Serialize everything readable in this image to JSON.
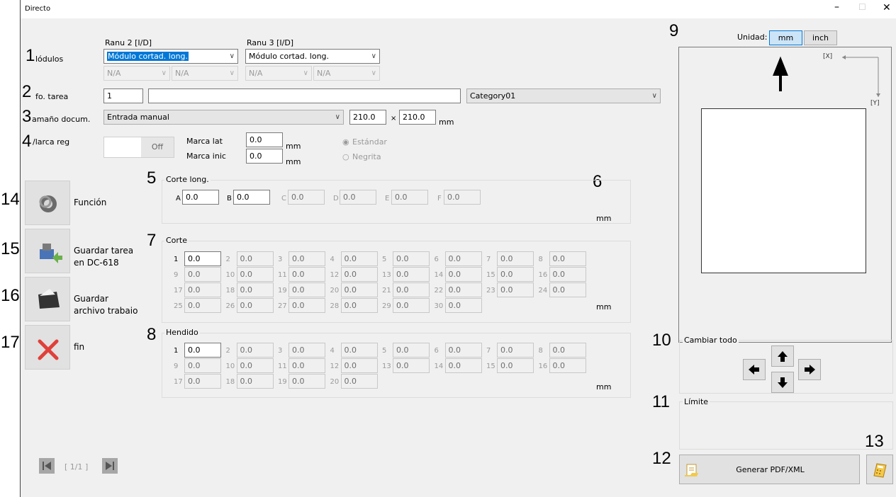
{
  "window": {
    "title": "Directo",
    "minimize": "–",
    "maximize": "☐",
    "close": "✕"
  },
  "callouts": {
    "n1": "1",
    "n2": "2",
    "n3": "3",
    "n4": "4",
    "n5": "5",
    "n6": "6",
    "n7": "7",
    "n8": "8",
    "n9": "9",
    "n10": "10",
    "n11": "11",
    "n12": "12",
    "n13": "13",
    "n14": "14",
    "n15": "15",
    "n16": "16",
    "n17": "17"
  },
  "modules": {
    "label": "lódulos",
    "col2_header": "Ranu 2 [I/D]",
    "col3_header": "Ranu 3 [I/D]",
    "col2_select": "Módulo cortad. long.",
    "col3_select": "Módulo cortad. long.",
    "na": "N/A"
  },
  "job": {
    "label": "fo. tarea",
    "number": "1",
    "name": "",
    "category": "Category01"
  },
  "docsize": {
    "label": "amaño docum.",
    "mode": "Entrada manual",
    "width": "210.0",
    "times": "×",
    "height": "210.0",
    "unit": "mm"
  },
  "regmark": {
    "label": "/larca reg",
    "toggle": "Off",
    "lat_label": "Marca lat",
    "lat_value": "0.0",
    "ini_label": "Marca inic",
    "ini_value": "0.0",
    "unit": "mm",
    "standard": "Estándar",
    "bold": "Negrita"
  },
  "slitter": {
    "title": "Corte long.",
    "unit": "mm",
    "fields": [
      {
        "key": "A",
        "value": "0.0",
        "enabled": true
      },
      {
        "key": "B",
        "value": "0.0",
        "enabled": true
      },
      {
        "key": "C",
        "value": "0.0",
        "enabled": false
      },
      {
        "key": "D",
        "value": "0.0",
        "enabled": false
      },
      {
        "key": "E",
        "value": "0.0",
        "enabled": false
      },
      {
        "key": "F",
        "value": "0.0",
        "enabled": false
      }
    ]
  },
  "cut": {
    "title": "Corte",
    "unit": "mm",
    "count": 30,
    "value": "0.0"
  },
  "crease": {
    "title": "Hendido",
    "unit": "mm",
    "count": 20,
    "value": "0.0"
  },
  "side": {
    "function": "Función",
    "save_dc_1": "Guardar tarea",
    "save_dc_2": "en DC-618",
    "save_file_1": "Guardar",
    "save_file_2": "archivo trabaio",
    "end": "fin"
  },
  "pager": {
    "text": "[ 1/1 ]"
  },
  "preview": {
    "unit_label": "Unidad:",
    "unit_mm": "mm",
    "unit_inch": "inch",
    "x_label": "[X]",
    "y_label": "[Y]"
  },
  "shift_all": {
    "title": "Cambiar todo"
  },
  "limit": {
    "title": "Límite"
  },
  "generate": {
    "label": "Generar PDF/XML"
  }
}
